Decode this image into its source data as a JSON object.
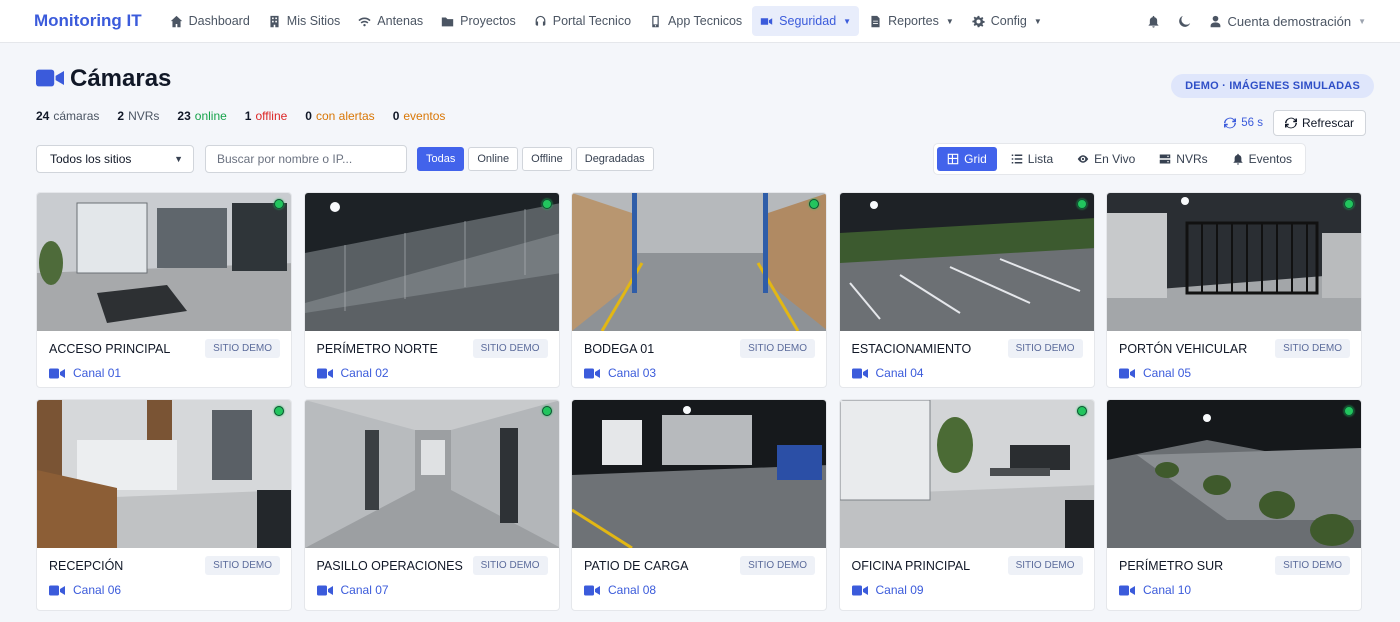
{
  "nav": {
    "brand": "Monitoring IT",
    "items": [
      {
        "label": "Dashboard",
        "icon": "home-icon"
      },
      {
        "label": "Mis Sitios",
        "icon": "building-icon"
      },
      {
        "label": "Antenas",
        "icon": "wifi-icon"
      },
      {
        "label": "Proyectos",
        "icon": "folder-icon"
      },
      {
        "label": "Portal Tecnico",
        "icon": "headset-icon"
      },
      {
        "label": "App Tecnicos",
        "icon": "mobile-icon"
      },
      {
        "label": "Seguridad",
        "icon": "video-icon"
      },
      {
        "label": "Reportes",
        "icon": "file-icon"
      },
      {
        "label": "Config",
        "icon": "gear-icon"
      }
    ],
    "account": "Cuenta demostración"
  },
  "header": {
    "title": "Cámaras",
    "demo_badge": "DEMO · IMÁGENES SIMULADAS",
    "stats": [
      {
        "value": "24",
        "label": "cámaras"
      },
      {
        "value": "2",
        "label": "NVRs"
      },
      {
        "value": "23",
        "label": "online"
      },
      {
        "value": "1",
        "label": "offline"
      },
      {
        "value": "0",
        "label": "con alertas"
      },
      {
        "value": "0",
        "label": "eventos"
      }
    ],
    "timer": "56 s",
    "refresh": "Refrescar"
  },
  "toolbar": {
    "site_select": "Todos los sitios",
    "search_placeholder": "Buscar por nombre o IP...",
    "filters": [
      "Todas",
      "Online",
      "Offline",
      "Degradadas"
    ],
    "views": [
      {
        "label": "Grid",
        "icon": "grid-icon"
      },
      {
        "label": "Lista",
        "icon": "list-icon"
      },
      {
        "label": "En Vivo",
        "icon": "eye-icon"
      },
      {
        "label": "NVRs",
        "icon": "server-icon"
      },
      {
        "label": "Eventos",
        "icon": "bell-icon"
      }
    ]
  },
  "cameras": [
    {
      "name": "ACCESO PRINCIPAL",
      "site": "SITIO DEMO",
      "channel": "Canal 01",
      "status": "online"
    },
    {
      "name": "PERÍMETRO NORTE",
      "site": "SITIO DEMO",
      "channel": "Canal 02",
      "status": "online"
    },
    {
      "name": "BODEGA 01",
      "site": "SITIO DEMO",
      "channel": "Canal 03",
      "status": "online"
    },
    {
      "name": "ESTACIONAMIENTO",
      "site": "SITIO DEMO",
      "channel": "Canal 04",
      "status": "online"
    },
    {
      "name": "PORTÓN VEHICULAR",
      "site": "SITIO DEMO",
      "channel": "Canal 05",
      "status": "online"
    },
    {
      "name": "RECEPCIÓN",
      "site": "SITIO DEMO",
      "channel": "Canal 06",
      "status": "online"
    },
    {
      "name": "PASILLO OPERACIONES",
      "site": "SITIO DEMO",
      "channel": "Canal 07",
      "status": "online"
    },
    {
      "name": "PATIO DE CARGA",
      "site": "SITIO DEMO",
      "channel": "Canal 08",
      "status": "online"
    },
    {
      "name": "OFICINA PRINCIPAL",
      "site": "SITIO DEMO",
      "channel": "Canal 09",
      "status": "online"
    },
    {
      "name": "PERÍMETRO SUR",
      "site": "SITIO DEMO",
      "channel": "Canal 10",
      "status": "online"
    }
  ]
}
